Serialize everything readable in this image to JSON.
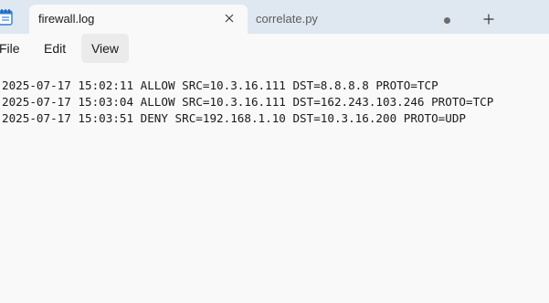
{
  "tabs": [
    {
      "label": "firewall.log",
      "active": true
    },
    {
      "label": "correlate.py",
      "active": false,
      "unsaved": true
    }
  ],
  "menu": {
    "file": "File",
    "edit": "Edit",
    "view": "View"
  },
  "editor": {
    "lines": [
      "2025-07-17 15:02:11 ALLOW SRC=10.3.16.111 DST=8.8.8.8 PROTO=TCP",
      "2025-07-17 15:03:04 ALLOW SRC=10.3.16.111 DST=162.243.103.246 PROTO=TCP",
      "2025-07-17 15:03:51 DENY SRC=192.168.1.10 DST=10.3.16.200 PROTO=UDP"
    ]
  },
  "colors": {
    "tabbar": "#dfe8f1",
    "background": "#f9f9f9",
    "icon_accent": "#2b7fd4"
  },
  "icons": {
    "app": "notepad-icon",
    "close": "close-icon",
    "unsaved": "unsaved-dot-icon",
    "new_tab": "plus-icon"
  }
}
